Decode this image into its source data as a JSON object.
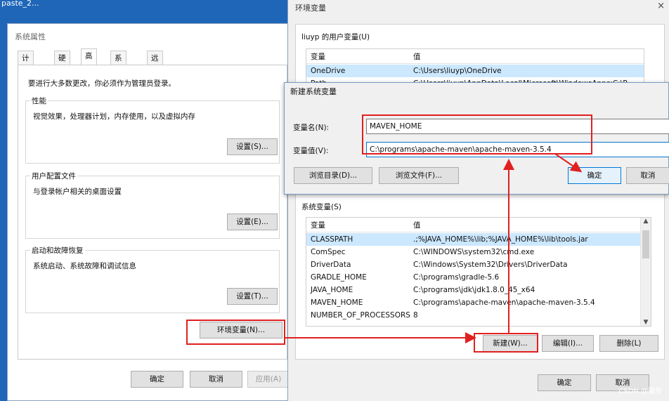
{
  "desktop": {
    "label": "paste_2..."
  },
  "system_properties": {
    "title": "系统属性",
    "tabs": [
      "计算机名",
      "硬件",
      "高级",
      "系统保护",
      "远程"
    ],
    "active_tab": "高级",
    "admin_notice": "要进行大多数更改，你必须作为管理员登录。",
    "groups": [
      {
        "title": "性能",
        "text": "视觉效果，处理器计划，内存使用，以及虚拟内存",
        "button": "设置(S)..."
      },
      {
        "title": "用户配置文件",
        "text": "与登录帐户相关的桌面设置",
        "button": "设置(E)..."
      },
      {
        "title": "启动和故障恢复",
        "text": "系统启动、系统故障和调试信息",
        "button": "设置(T)..."
      }
    ],
    "env_button": "环境变量(N)...",
    "footer": {
      "ok": "确定",
      "cancel": "取消",
      "apply": "应用(A)"
    }
  },
  "env_vars": {
    "title": "环境变量",
    "close": "×",
    "user_section": "liuyp 的用户变量(U)",
    "user_headers": {
      "name": "变量",
      "value": "值"
    },
    "user_rows": [
      {
        "name": "OneDrive",
        "value": "C:\\Users\\liuyp\\OneDrive"
      },
      {
        "name": "Path",
        "value": "C:\\Users\\liuyp\\AppData\\Local\\Microsoft\\WindowsApps;C:\\P"
      }
    ],
    "system_section": "系统变量(S)",
    "system_headers": {
      "name": "变量",
      "value": "值"
    },
    "system_rows": [
      {
        "name": "CLASSPATH",
        "value": ".;%JAVA_HOME%\\lib;%JAVA_HOME%\\lib\\tools.jar"
      },
      {
        "name": "ComSpec",
        "value": "C:\\WINDOWS\\system32\\cmd.exe"
      },
      {
        "name": "DriverData",
        "value": "C:\\Windows\\System32\\Drivers\\DriverData"
      },
      {
        "name": "GRADLE_HOME",
        "value": "C:\\programs\\gradle-5.6"
      },
      {
        "name": "JAVA_HOME",
        "value": "C:\\programs\\jdk\\jdk1.8.0_45_x64"
      },
      {
        "name": "MAVEN_HOME",
        "value": "C:\\programs\\apache-maven\\apache-maven-3.5.4"
      },
      {
        "name": "NUMBER_OF_PROCESSORS",
        "value": "8"
      }
    ],
    "system_buttons": {
      "new": "新建(W)...",
      "edit": "编辑(I)...",
      "delete": "删除(L)"
    },
    "footer": {
      "ok": "确定",
      "cancel": "取消"
    }
  },
  "new_var_dialog": {
    "title": "新建系统变量",
    "name_label": "变量名(N):",
    "name_value": "MAVEN_HOME",
    "value_label": "变量值(V):",
    "value_value": "C:\\programs\\apache-maven\\apache-maven-3.5.4",
    "browse_dir": "浏览目录(D)...",
    "browse_file": "浏览文件(F)...",
    "ok": "确定",
    "cancel": "取消"
  },
  "watermark": "CSDN @骚夸",
  "colors": {
    "highlight": "#e0201f",
    "selection": "#cce8ff",
    "accent": "#0078d7"
  }
}
